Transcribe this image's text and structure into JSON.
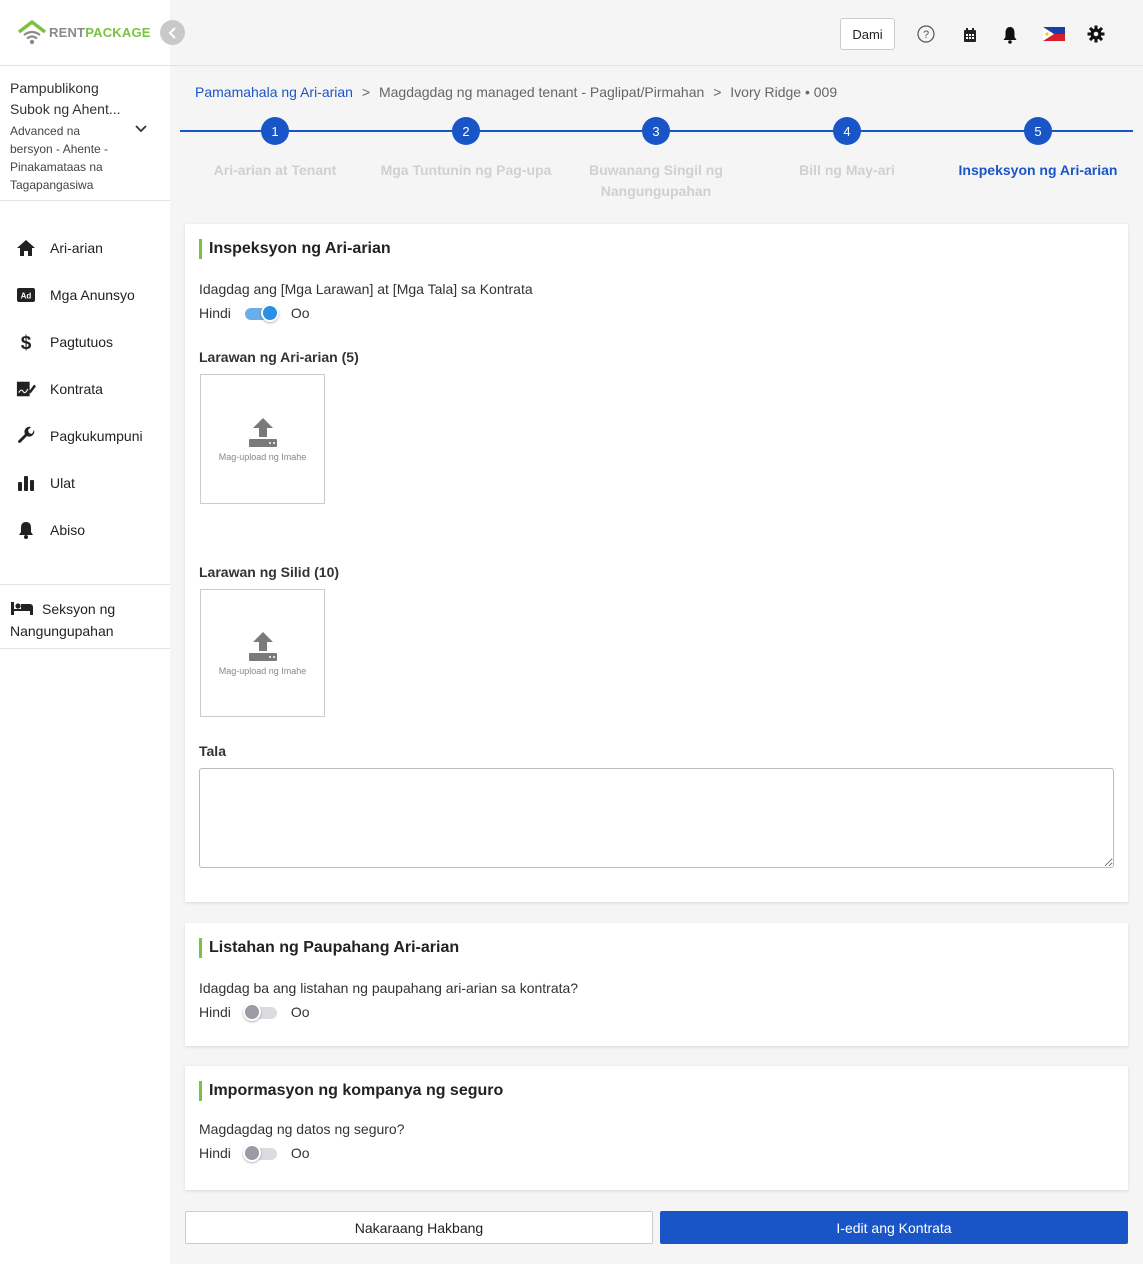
{
  "brand": {
    "rent": "RENT",
    "package": "PACKAGE",
    "accent": "#7cc242",
    "primary": "#1a55c8"
  },
  "org": {
    "name_line1": "Pampublikong",
    "name_line2": "Subok ng Ahent...",
    "sub_line1": "Advanced na",
    "sub_line2": "bersyon - Ahente -",
    "sub_line3": "Pinakamataas na",
    "sub_line4": "Tagapangasiwa"
  },
  "sidebar": {
    "items": [
      {
        "label": "Ari-arian",
        "icon": "home-icon"
      },
      {
        "label": "Mga Anunsyo",
        "icon": "ad-icon"
      },
      {
        "label": "Pagtutuos",
        "icon": "dollar-icon"
      },
      {
        "label": "Kontrata",
        "icon": "contract-icon"
      },
      {
        "label": "Pagkukumpuni",
        "icon": "wrench-icon"
      },
      {
        "label": "Ulat",
        "icon": "bar-chart-icon"
      },
      {
        "label": "Abiso",
        "icon": "bell-icon"
      }
    ],
    "tenant_line1": "Seksyon ng",
    "tenant_line2": "Nangungupahan"
  },
  "header": {
    "dami_label": "Dami"
  },
  "breadcrumb": {
    "item1": "Pamamahala ng Ari-arian",
    "sep": ">",
    "item2": "Magdagdag ng managed tenant - Paglipat/Pirmahan",
    "item3": "Ivory Ridge • 009"
  },
  "stepper": {
    "steps": [
      {
        "num": "1",
        "label": "Ari-arian at Tenant"
      },
      {
        "num": "2",
        "label": "Mga Tuntunin ng Pag-upa"
      },
      {
        "num": "3",
        "label": "Buwanang Singil ng Nangungupahan"
      },
      {
        "num": "4",
        "label": "Bill ng May-ari"
      },
      {
        "num": "5",
        "label": "Inspeksyon ng Ari-arian"
      }
    ],
    "active_step": 5
  },
  "inspection": {
    "title": "Inspeksyon ng Ari-arian",
    "question": "Idagdag ang [Mga Larawan] at [Mga Tala] sa Kontrata",
    "no": "Hindi",
    "yes": "Oo",
    "toggle_on": true,
    "property_photos_label": "Larawan ng Ari-arian (5)",
    "room_photos_label": "Larawan ng Silid (10)",
    "upload_text": "Mag-upload ng Imahe",
    "notes_label": "Tala",
    "notes_value": ""
  },
  "listing": {
    "title": "Listahan ng Paupahang Ari-arian",
    "question": "Idagdag ba ang listahan ng paupahang ari-arian sa kontrata?",
    "no": "Hindi",
    "yes": "Oo",
    "toggle_on": false
  },
  "insurance": {
    "title": "Impormasyon ng kompanya ng seguro",
    "question": "Magdagdag ng datos ng seguro?",
    "no": "Hindi",
    "yes": "Oo",
    "toggle_on": false
  },
  "actions": {
    "prev": "Nakaraang Hakbang",
    "edit": "I-edit ang Kontrata"
  }
}
